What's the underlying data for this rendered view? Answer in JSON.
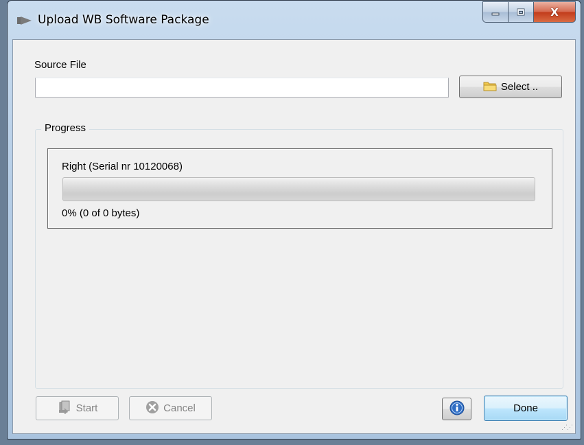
{
  "window": {
    "title": "Upload WB Software Package",
    "close_glyph": "X"
  },
  "source": {
    "label": "Source File",
    "value": "",
    "placeholder": "",
    "select_label": "Select .."
  },
  "progress_group": {
    "title": "Progress",
    "device": "Right (Serial nr 10120068)",
    "percent": 0,
    "status_text": "0% (0 of 0 bytes)"
  },
  "buttons": {
    "start_label": "Start",
    "cancel_label": "Cancel",
    "done_label": "Done"
  },
  "icons": {
    "title": "play-arrow-icon",
    "select": "folder-icon",
    "start": "upload-package-icon",
    "cancel": "cancel-x-icon",
    "info": "info-icon"
  },
  "colors": {
    "info_blue": "#2f6dc4",
    "progress_green": "#06b025",
    "close_red": "#c23c1c"
  }
}
